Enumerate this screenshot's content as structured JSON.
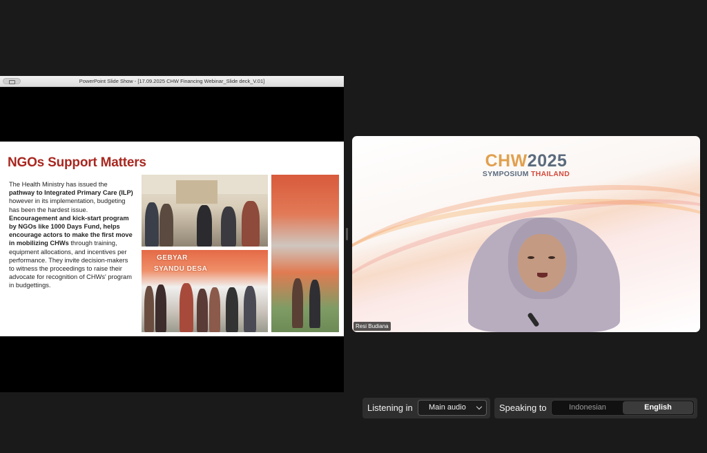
{
  "share": {
    "window_title": "PowerPoint Slide Show - [17.09.2025 CHW Financing Webinar_Slide deck_V.01]",
    "slide": {
      "title": "NGOs Support Matters",
      "body_parts": [
        "The Health Ministry has issued the ",
        "pathway to Integrated Primary Care (ILP)",
        " however in its implementation, budgeting has been the hardest issue. ",
        "Encouragement and kick-start program by NGOs like 1000 Days Fund, helps encourage actors to make the first move in mobilizing CHWs",
        " through training, equipment allocations, and incentives per performance. They invite decision-makers to witness the proceedings to raise their advocate for recognition of CHWs' program in budgettings."
      ],
      "photo_banner_1": "GEBYAR",
      "photo_banner_2": "SYANDU DESA"
    }
  },
  "video": {
    "brand_chw": "CHW",
    "brand_year": "2025",
    "brand_symposium": "SYMPOSIUM",
    "brand_country": "THAILAND",
    "participant_name": "Resi Budiana"
  },
  "interpretation": {
    "listening_label": "Listening in",
    "audio_selected": "Main audio",
    "speaking_label": "Speaking to",
    "lang_options": [
      "Indonesian",
      "English"
    ],
    "lang_selected": "English"
  }
}
